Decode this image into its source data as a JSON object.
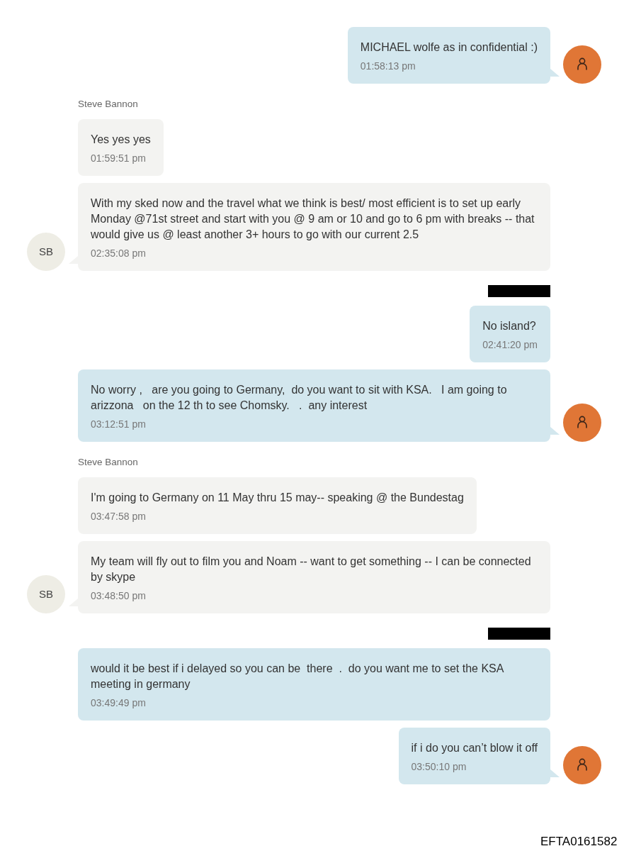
{
  "thread": [
    {
      "kind": "outgoing",
      "sender_redacted": false,
      "messages": [
        {
          "text": "MICHAEL wolfe as in confidential :)",
          "time": "01:58:13 pm"
        }
      ]
    },
    {
      "kind": "incoming",
      "sender": "Steve Bannon",
      "avatar_initials": "SB",
      "messages": [
        {
          "text": "Yes yes yes",
          "time": "01:59:51 pm"
        },
        {
          "text": "With my sked now and the travel what we think is best/ most efficient is to set up early Monday @71st street and start with you @ 9 am or 10 and go to 6 pm with breaks -- that would give us @ least another 3+ hours to go with our current 2.5",
          "time": "02:35:08 pm"
        }
      ]
    },
    {
      "kind": "outgoing",
      "sender_redacted": true,
      "messages": [
        {
          "text": "No island?",
          "time": "02:41:20 pm"
        },
        {
          "text": "No worry ,   are you going to Germany,  do you want to sit with KSA.   I am going to arizzona   on the 12 th to see Chomsky.   .  any interest",
          "time": "03:12:51 pm"
        }
      ]
    },
    {
      "kind": "incoming",
      "sender": "Steve Bannon",
      "avatar_initials": "SB",
      "messages": [
        {
          "text": "I'm going to Germany on 11 May thru 15 may-- speaking @ the Bundestag",
          "time": "03:47:58 pm"
        },
        {
          "text": "My team will fly out to film you and Noam -- want to get something -- I can be connected by skype",
          "time": "03:48:50 pm"
        }
      ]
    },
    {
      "kind": "outgoing",
      "sender_redacted": true,
      "messages": [
        {
          "text": "would it be best if i delayed so you can be  there  .  do you want me to set the KSA meeting in germany",
          "time": "03:49:49 pm"
        },
        {
          "text": "if i do you can’t blow it off",
          "time": "03:50:10 pm"
        }
      ]
    }
  ],
  "document_id": "EFTA0161582"
}
